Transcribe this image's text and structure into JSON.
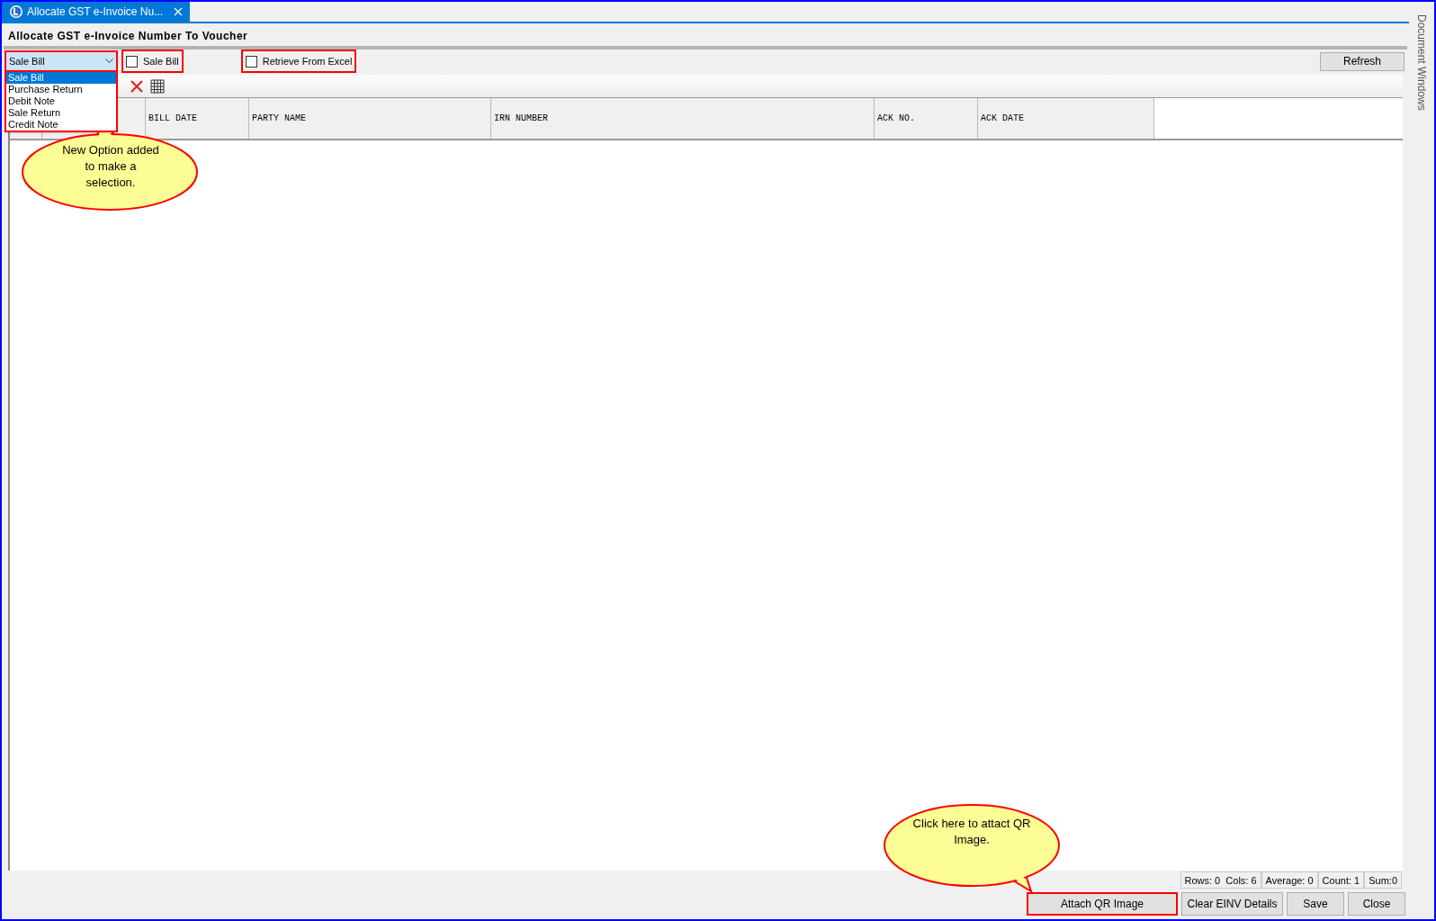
{
  "tab": {
    "title": "Allocate GST e-Invoice Nu...",
    "selected": true
  },
  "form_title": "Allocate GST e-Invoice Number To Voucher",
  "voucher_type": {
    "value": "Sale Bill",
    "highlighted": true,
    "expanded": true,
    "options": [
      {
        "label": "Sale Bill",
        "selected": true
      },
      {
        "label": "Purchase Return",
        "selected": false
      },
      {
        "label": "Debit Note",
        "selected": false
      },
      {
        "label": "Sale Return",
        "selected": false
      },
      {
        "label": "Credit Note",
        "selected": false
      }
    ]
  },
  "toolbar_items": [
    {
      "kind": "checkbox",
      "label": "Sale Bill",
      "checked": false,
      "outlined": true
    },
    {
      "kind": "checkbox",
      "label": "Retrieve From Excel",
      "checked": false,
      "outlined": true
    }
  ],
  "refresh_button": "Refresh",
  "table": {
    "columns": [
      {
        "kind": "blank"
      },
      {
        "kind": "blank"
      },
      {
        "kind": "text",
        "label": "BILL DATE"
      },
      {
        "kind": "text",
        "label": "PARTY NAME"
      },
      {
        "kind": "text",
        "label": "IRN NUMBER"
      },
      {
        "kind": "text",
        "label": "ACK NO."
      },
      {
        "kind": "text",
        "label": "ACK DATE"
      }
    ]
  },
  "status_bar": [
    "Rows: 0  Cols: 6",
    "Average: 0",
    "Count: 1",
    "Sum:0"
  ],
  "buttons": [
    {
      "label": "Attach QR Image",
      "highlighted": true
    },
    {
      "label": "Clear EINV Details",
      "highlighted": false
    },
    {
      "label": "Save",
      "highlighted": false
    },
    {
      "label": "Close",
      "highlighted": false
    }
  ],
  "side_panel": "Document Windows",
  "callouts": [
    {
      "text": "New Option added to make a selection."
    },
    {
      "text": "Click here to attact QR Image."
    }
  ]
}
